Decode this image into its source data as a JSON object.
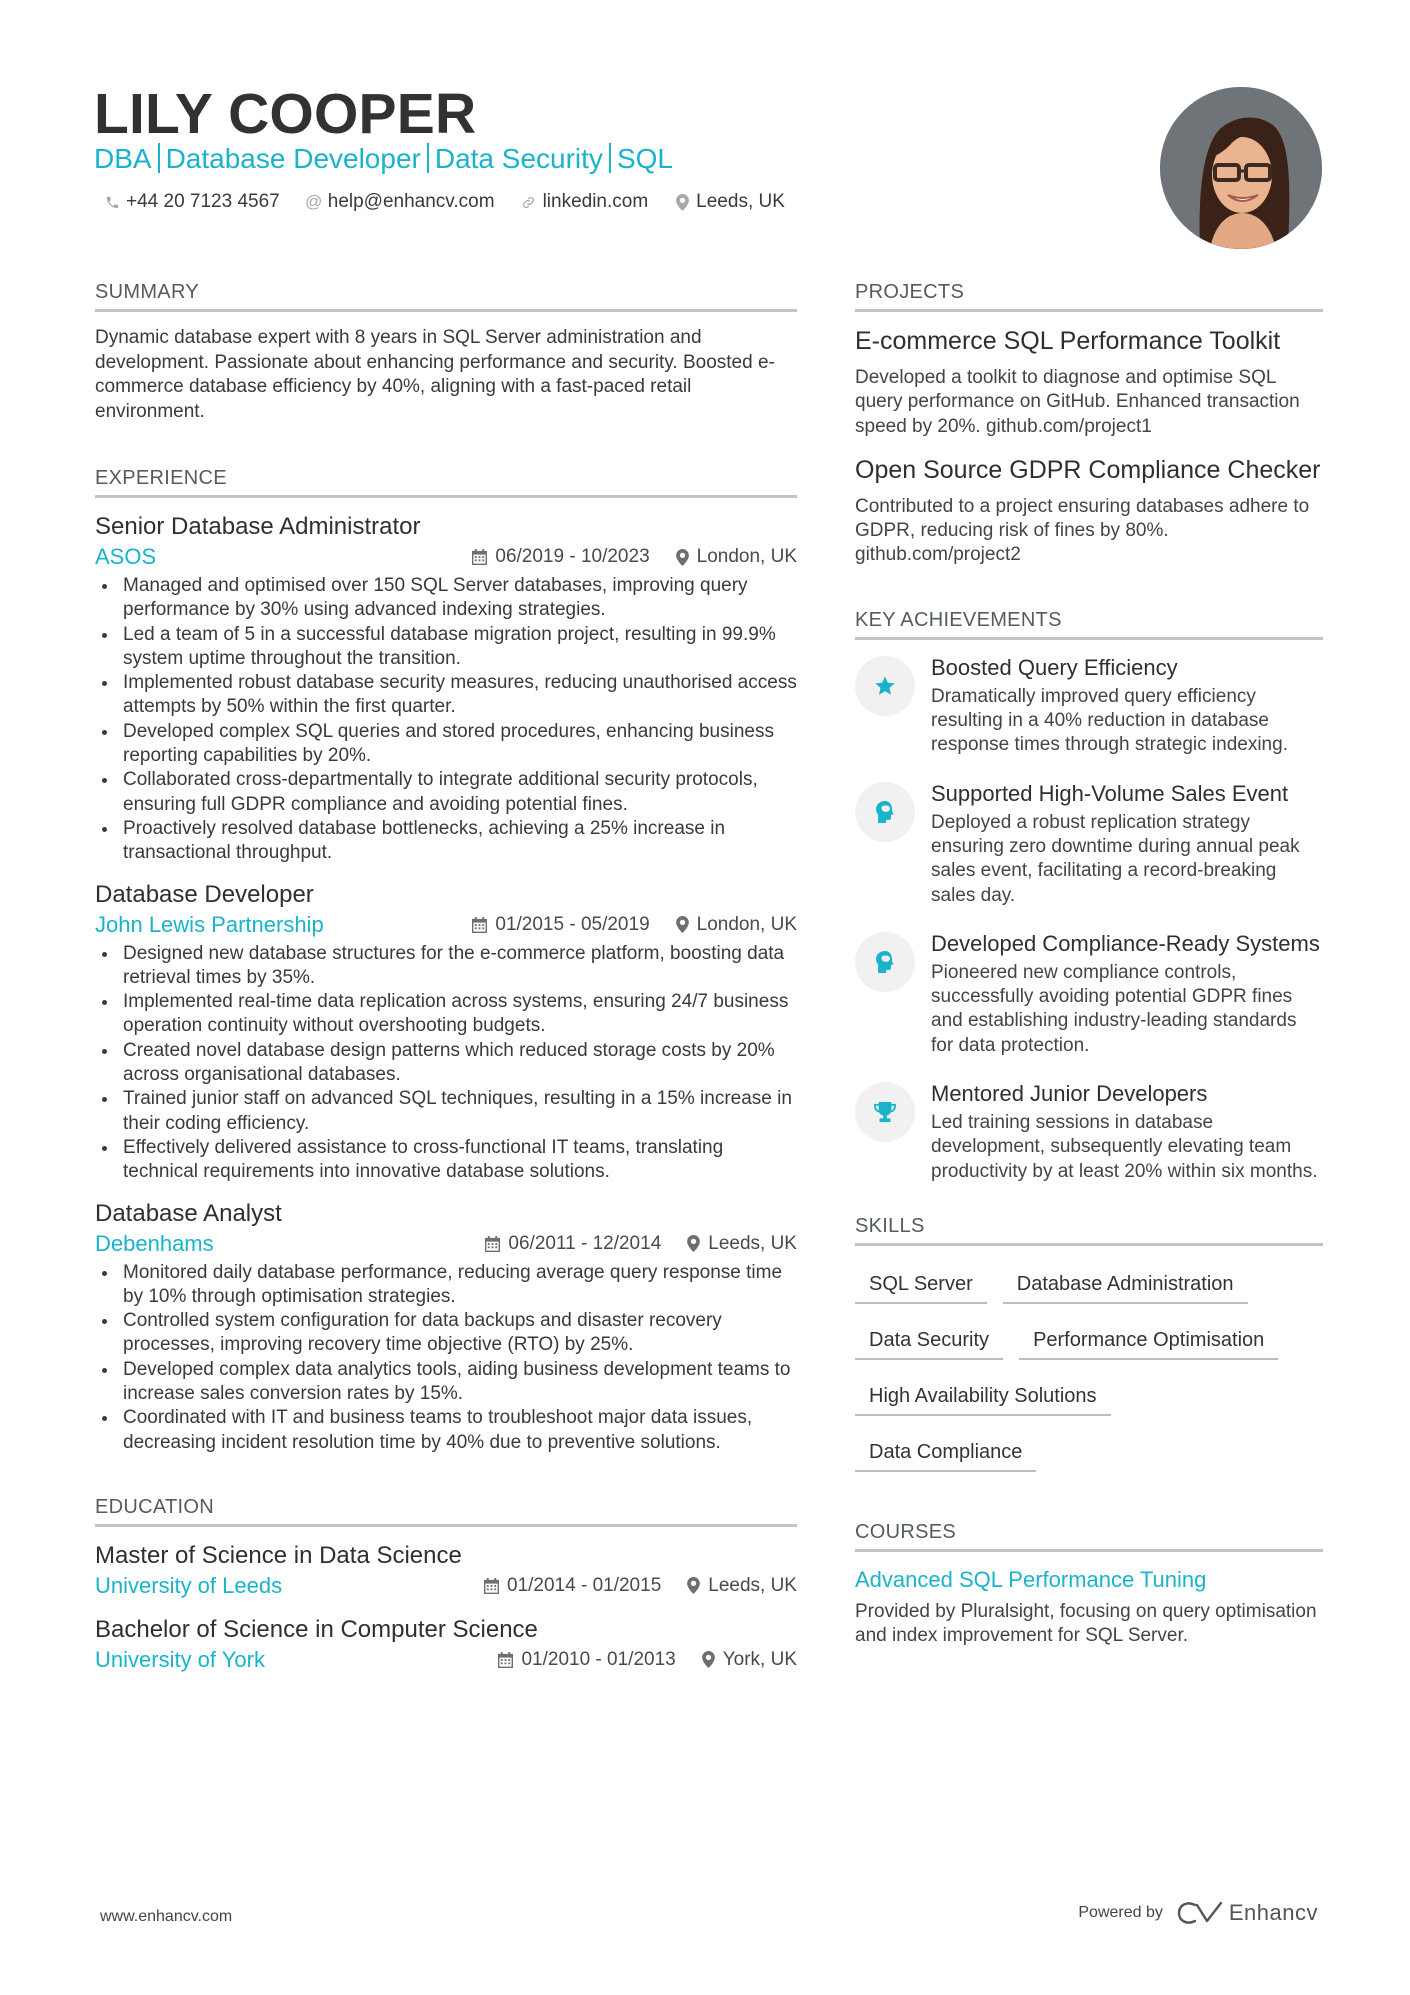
{
  "header": {
    "name": "LILY COOPER",
    "headline_parts": [
      "DBA",
      "Database Developer",
      "Data Security",
      "SQL"
    ],
    "contacts": [
      {
        "icon": "phone-icon",
        "text": "+44 20 7123 4567"
      },
      {
        "icon": "at-icon",
        "text": "help@enhancv.com"
      },
      {
        "icon": "link-icon",
        "text": "linkedin.com"
      },
      {
        "icon": "location-icon",
        "text": "Leeds, UK"
      }
    ],
    "photo_alt": "Profile photo"
  },
  "colors": {
    "accent": "#1ab3cc",
    "text": "#3a3a3a",
    "rule": "#c3c3c3",
    "icon_bg": "#f1f1f1"
  },
  "summary": {
    "title": "SUMMARY",
    "text": "Dynamic database expert with 8 years in SQL Server administration and development. Passionate about enhancing performance and security. Boosted e-commerce database efficiency by 40%, aligning with a fast-paced retail environment."
  },
  "experience": {
    "title": "EXPERIENCE",
    "jobs": [
      {
        "title": "Senior Database Administrator",
        "company": "ASOS",
        "dates": "06/2019 - 10/2023",
        "location": "London, UK",
        "bullets": [
          "Managed and optimised over 150 SQL Server databases, improving query performance by 30% using advanced indexing strategies.",
          "Led a team of 5 in a successful database migration project, resulting in 99.9% system uptime throughout the transition.",
          "Implemented robust database security measures, reducing unauthorised access attempts by 50% within the first quarter.",
          "Developed complex SQL queries and stored procedures, enhancing business reporting capabilities by 20%.",
          "Collaborated cross-departmentally to integrate additional security protocols, ensuring full GDPR compliance and avoiding potential fines.",
          "Proactively resolved database bottlenecks, achieving a 25% increase in transactional throughput."
        ]
      },
      {
        "title": "Database Developer",
        "company": "John Lewis Partnership",
        "dates": "01/2015 - 05/2019",
        "location": "London, UK",
        "bullets": [
          "Designed new database structures for the e-commerce platform, boosting data retrieval times by 35%.",
          "Implemented real-time data replication across systems, ensuring 24/7 business operation continuity without overshooting budgets.",
          "Created novel database design patterns which reduced storage costs by 20% across organisational databases.",
          "Trained junior staff on advanced SQL techniques, resulting in a 15% increase in their coding efficiency.",
          "Effectively delivered assistance to cross-functional IT teams, translating technical requirements into innovative database solutions."
        ]
      },
      {
        "title": "Database Analyst",
        "company": "Debenhams",
        "dates": "06/2011 - 12/2014",
        "location": "Leeds, UK",
        "bullets": [
          "Monitored daily database performance, reducing average query response time by 10% through optimisation strategies.",
          "Controlled system configuration for data backups and disaster recovery processes, improving recovery time objective (RTO) by 25%.",
          "Developed complex data analytics tools, aiding business development teams to increase sales conversion rates by 15%.",
          "Coordinated with IT and business teams to troubleshoot major data issues, decreasing incident resolution time by 40% due to preventive solutions."
        ]
      }
    ]
  },
  "education": {
    "title": "EDUCATION",
    "items": [
      {
        "degree": "Master of Science in Data Science",
        "school": "University of Leeds",
        "dates": "01/2014 - 01/2015",
        "location": "Leeds, UK"
      },
      {
        "degree": "Bachelor of Science in Computer Science",
        "school": "University of York",
        "dates": "01/2010 - 01/2013",
        "location": "York, UK"
      }
    ]
  },
  "projects": {
    "title": "PROJECTS",
    "items": [
      {
        "title": "E-commerce SQL Performance Toolkit",
        "desc": "Developed a toolkit to diagnose and optimise SQL query performance on GitHub. Enhanced transaction speed by 20%. github.com/project1"
      },
      {
        "title": "Open Source GDPR Compliance Checker",
        "desc": "Contributed to a project ensuring databases adhere to GDPR, reducing risk of fines by 80%. github.com/project2"
      }
    ]
  },
  "achievements": {
    "title": "KEY ACHIEVEMENTS",
    "items": [
      {
        "icon": "star-icon",
        "title": "Boosted Query Efficiency",
        "desc": "Dramatically improved query efficiency resulting in a 40% reduction in database response times through strategic indexing."
      },
      {
        "icon": "head-brain-icon",
        "title": "Supported High-Volume Sales Event",
        "desc": "Deployed a robust replication strategy ensuring zero downtime during annual peak sales event, facilitating a record-breaking sales day."
      },
      {
        "icon": "head-brain-icon",
        "title": "Developed Compliance-Ready Systems",
        "desc": "Pioneered new compliance controls, successfully avoiding potential GDPR fines and establishing industry-leading standards for data protection."
      },
      {
        "icon": "trophy-icon",
        "title": "Mentored Junior Developers",
        "desc": "Led training sessions in database development, subsequently elevating team productivity by at least 20% within six months."
      }
    ]
  },
  "skills": {
    "title": "SKILLS",
    "items": [
      "SQL Server",
      "Database Administration",
      "Data Security",
      "Performance Optimisation",
      "High Availability Solutions",
      "Data Compliance"
    ]
  },
  "courses": {
    "title": "COURSES",
    "items": [
      {
        "title": "Advanced SQL Performance Tuning",
        "desc": "Provided by Pluralsight, focusing on query optimisation and index improvement for SQL Server."
      }
    ]
  },
  "footer": {
    "website": "www.enhancv.com",
    "powered_by": "Powered by",
    "brand": "Enhancv"
  }
}
